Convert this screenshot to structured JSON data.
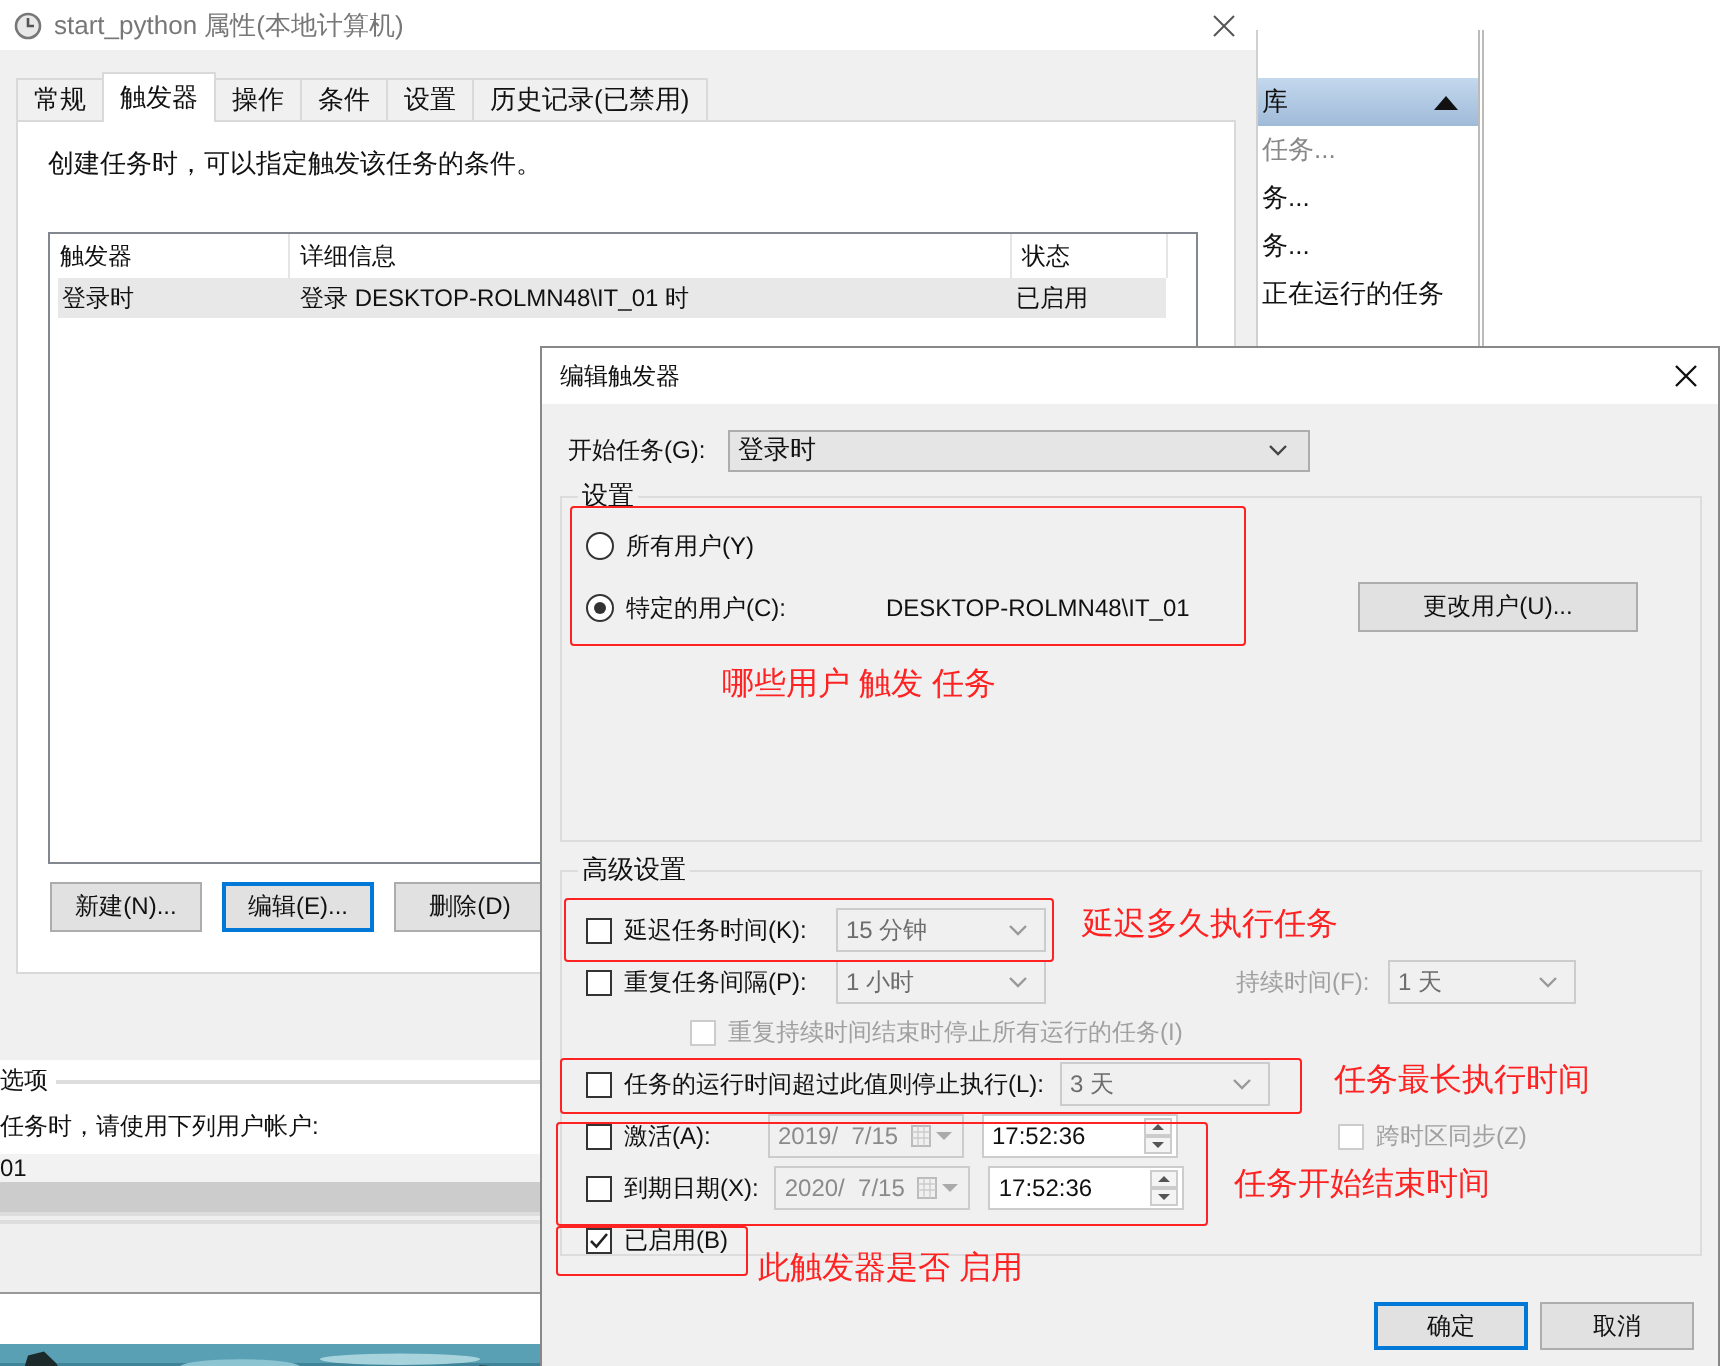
{
  "properties_window": {
    "title": "start_python 属性(本地计算机)",
    "tabs": [
      {
        "label": "常规",
        "selected": false
      },
      {
        "label": "触发器",
        "selected": true
      },
      {
        "label": "操作",
        "selected": false
      },
      {
        "label": "条件",
        "selected": false
      },
      {
        "label": "设置",
        "selected": false
      },
      {
        "label": "历史记录(已禁用)",
        "selected": false
      }
    ],
    "description": "创建任务时，可以指定触发该任务的条件。",
    "table": {
      "columns": [
        "触发器",
        "详细信息",
        "状态"
      ],
      "rows": [
        {
          "cells": [
            "登录时",
            "登录 DESKTOP-ROLMN48\\IT_01 时",
            "已启用"
          ],
          "selected": true
        }
      ]
    },
    "buttons": [
      {
        "label": "新建(N)...",
        "default": false
      },
      {
        "label": "编辑(E)...",
        "default": true
      },
      {
        "label": "删除(D)",
        "default": false
      }
    ]
  },
  "actions_panel": {
    "header": "库",
    "items": [
      {
        "label": "任务...",
        "disabled": true
      },
      {
        "label": "务...",
        "disabled": false
      },
      {
        "label": "务...",
        "disabled": false
      },
      {
        "label": "正在运行的任务",
        "disabled": false
      }
    ]
  },
  "lower_window": {
    "section": "选项",
    "text": "任务时，请使用下列用户帐户:",
    "account": "01"
  },
  "dialog": {
    "title": "编辑触发器",
    "start_label": "开始任务(G):",
    "start_value": "登录时",
    "settings": {
      "legend": "设置",
      "radios": [
        {
          "label": "所有用户(Y)",
          "selected": false
        },
        {
          "label": "特定的用户(C):",
          "selected": true
        }
      ],
      "user": "DESKTOP-ROLMN48\\IT_01",
      "change_button": "更改用户(U)..."
    },
    "advanced": {
      "legend": "高级设置",
      "rows": [
        {
          "kind": "dropdown",
          "label": "延迟任务时间(K):",
          "checked": false,
          "value": "15 分钟",
          "disabled": true
        },
        {
          "kind": "dropdown",
          "label": "重复任务间隔(P):",
          "checked": false,
          "value": "1 小时",
          "disabled": true,
          "extra_label": "持续时间(F):",
          "extra_value": "1 天"
        },
        {
          "kind": "sub",
          "label": "重复持续时间结束时停止所有运行的任务(I)",
          "checked": false,
          "disabled": true
        },
        {
          "kind": "dropdown",
          "label": "任务的运行时间超过此值则停止执行(L):",
          "checked": false,
          "value": "3 天",
          "disabled": true
        },
        {
          "kind": "datetime",
          "label": "激活(A):",
          "checked": false,
          "date": "2019/  7/15",
          "time": "17:52:36",
          "sync": "跨时区同步(Z)",
          "sync_checked": false,
          "disabled": true
        },
        {
          "kind": "datetime",
          "label": "到期日期(X):",
          "checked": false,
          "date": "2020/  7/15",
          "time": "17:52:36",
          "disabled": true
        },
        {
          "kind": "check",
          "label": "已启用(B)",
          "checked": true
        }
      ]
    },
    "buttons": [
      {
        "label": "确定",
        "default": true
      },
      {
        "label": "取消",
        "default": false
      }
    ]
  },
  "annotations": [
    {
      "text": "哪些用户 触发 任务"
    },
    {
      "text": "延迟多久执行任务"
    },
    {
      "text": "任务最长执行时间"
    },
    {
      "text": "任务开始结束时间"
    },
    {
      "text": "此触发器是否 启用"
    }
  ]
}
